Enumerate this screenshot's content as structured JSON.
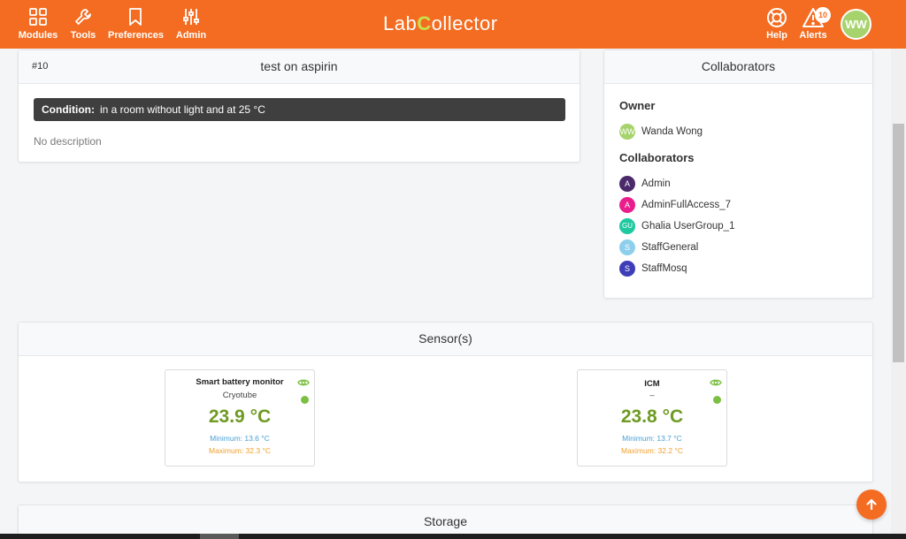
{
  "topbar": {
    "nav": [
      {
        "label": "Modules",
        "icon": "modules-grid-icon"
      },
      {
        "label": "Tools",
        "icon": "wrench-icon"
      },
      {
        "label": "Preferences",
        "icon": "bookmark-icon"
      },
      {
        "label": "Admin",
        "icon": "sliders-icon"
      }
    ],
    "logo_pre": "Lab",
    "logo_c": "C",
    "logo_post": "ollector",
    "help_label": "Help",
    "alerts_label": "Alerts",
    "alerts_count": "10",
    "user_initials": "WW",
    "color_bar": "#f36c21"
  },
  "experiment": {
    "id": "#10",
    "title": "test on aspirin",
    "condition_label": "Condition:",
    "condition_text": "in a room without light and at 25 °C",
    "description": "No description"
  },
  "collaborators_panel": {
    "title": "Collaborators",
    "owner_heading": "Owner",
    "owner": {
      "initials": "WW",
      "name": "Wanda Wong",
      "color": "#a6d36c"
    },
    "collaborators_heading": "Collaborators",
    "people": [
      {
        "initials": "A",
        "name": "Admin",
        "color": "#4b2a6b"
      },
      {
        "initials": "A",
        "name": "AdminFullAccess_7",
        "color": "#e91e8c"
      },
      {
        "initials": "GU",
        "name": "Ghalia UserGroup_1",
        "color": "#1fc9a0"
      },
      {
        "initials": "S",
        "name": "StaffGeneral",
        "color": "#8ecfee"
      },
      {
        "initials": "S",
        "name": "StaffMosq",
        "color": "#3d3db8"
      }
    ]
  },
  "sensors": {
    "title": "Sensor(s)",
    "items": [
      {
        "name": "Smart battery monitor",
        "subtitle": "Cryotube",
        "temperature": "23.9 °C",
        "minimum": "Minimum: 13.6 °C",
        "maximum": "Maximum: 32.3 °C"
      },
      {
        "name": "ICM",
        "subtitle": "–",
        "temperature": "23.8 °C",
        "minimum": "Minimum: 13.7 °C",
        "maximum": "Maximum: 32.2 °C"
      }
    ]
  },
  "storage": {
    "title": "Storage"
  }
}
